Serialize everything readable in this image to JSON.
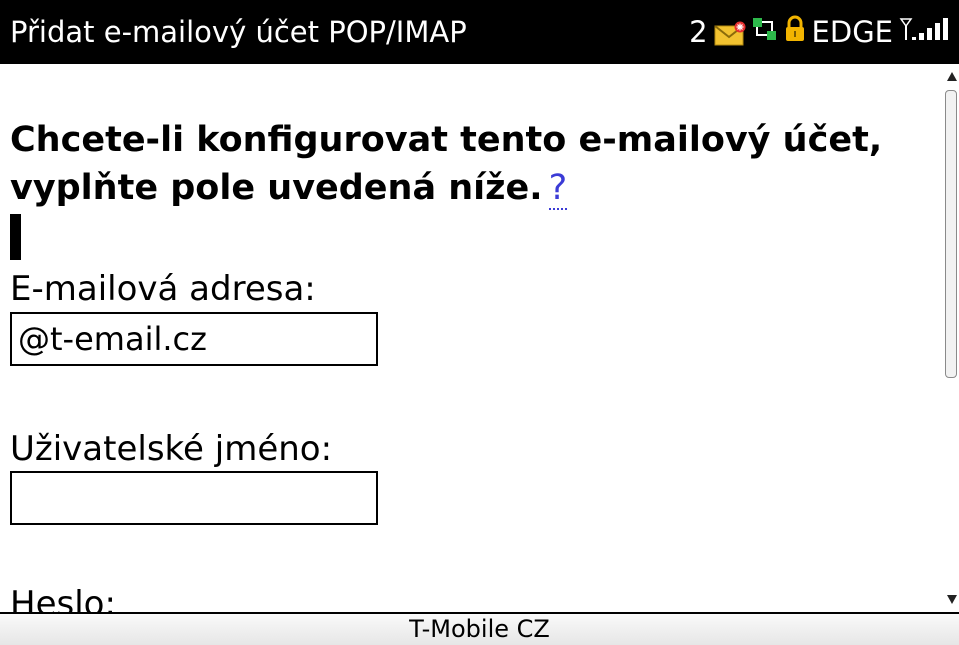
{
  "titlebar": {
    "title": "Přidat e-mailový účet POP/IMAP",
    "unread_count": "2",
    "network_label": "EDGE",
    "icons": [
      "mail-new-icon",
      "data-transfer-icon",
      "lock-icon",
      "signal-icon"
    ]
  },
  "form": {
    "heading": "Chcete-li konfigurovat tento e-mailový účet, vyplňte pole uvedená níže.",
    "help_link": "?",
    "email_label": "E-mailová adresa:",
    "email_value": "@t-email.cz",
    "username_label": "Uživatelské jméno:",
    "username_value": "",
    "password_label": "Heslo:"
  },
  "footer": {
    "carrier": "T-Mobile CZ"
  },
  "colors": {
    "titlebar_bg": "#000000",
    "link": "#3b3bd6",
    "mail_icon": "#f2c230",
    "lock_icon": "#f2b400",
    "network_icon": "#2db84b"
  }
}
